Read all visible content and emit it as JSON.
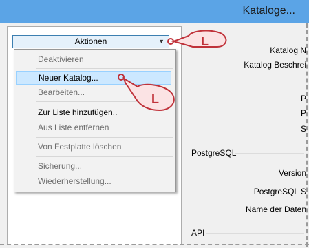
{
  "window": {
    "title": "Kataloge..."
  },
  "actions": {
    "label": "Aktionen"
  },
  "menu": {
    "items": [
      {
        "label": "Deaktivieren",
        "enabled": false
      },
      {
        "label": "Neuer Katalog...",
        "enabled": true
      },
      {
        "label": "Bearbeiten...",
        "enabled": false
      },
      {
        "label": "Zur Liste hinzufügen..",
        "enabled": true
      },
      {
        "label": "Aus Liste entfernen",
        "enabled": false
      },
      {
        "label": "Von Festplatte löschen",
        "enabled": false
      },
      {
        "label": "Sicherung...",
        "enabled": false
      },
      {
        "label": "Wiederherstellung...",
        "enabled": false
      }
    ]
  },
  "details": {
    "catalog_labels": [
      "Katalog N",
      "Katalog Beschrei",
      "P",
      "P",
      "S"
    ],
    "postgres": {
      "title": "PostgreSQL",
      "labels": [
        "Version",
        "PostgreSQL S",
        "Name der Daten"
      ]
    },
    "api": {
      "title": "API"
    }
  },
  "cursor_badge": {
    "label": "L"
  },
  "colors": {
    "titlebar": "#5ba4e6",
    "highlight": "#cce8ff",
    "cursor_red": "#c0323a"
  }
}
